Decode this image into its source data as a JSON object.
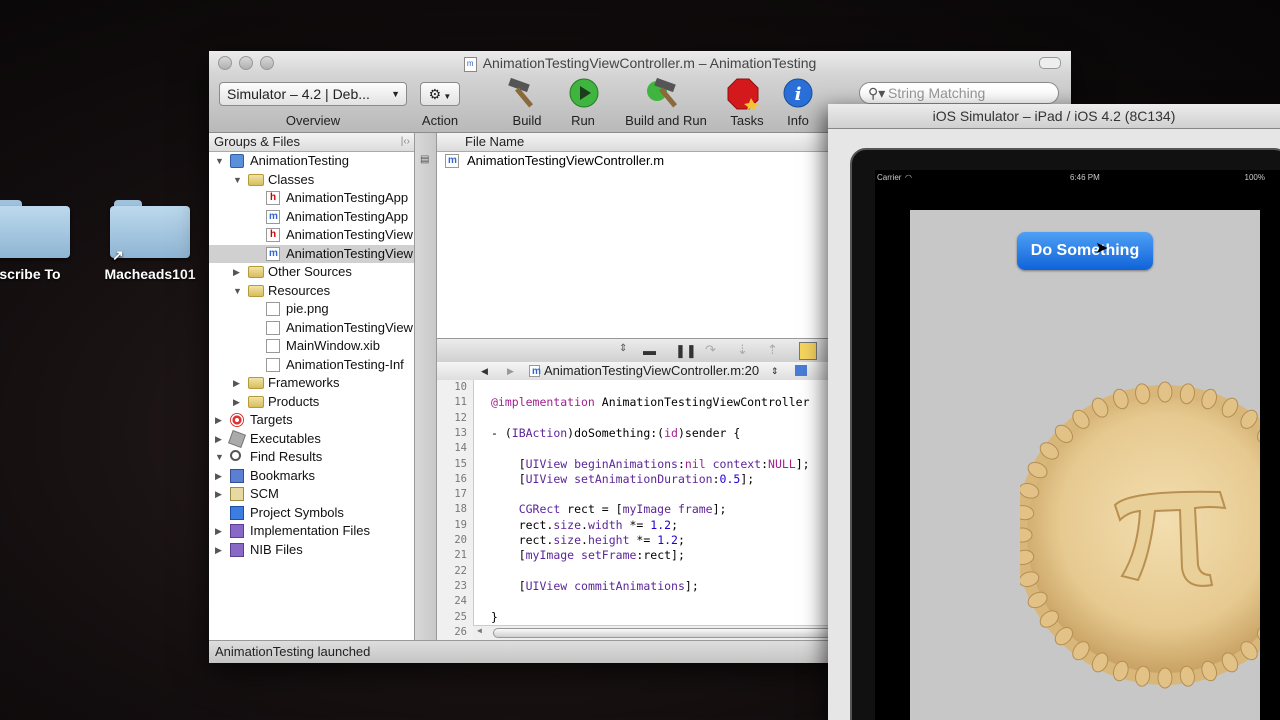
{
  "desktop": {
    "folders": [
      {
        "label": "scribe To"
      },
      {
        "label": "Macheads101"
      }
    ]
  },
  "xcode": {
    "title": "AnimationTestingViewController.m – AnimationTesting",
    "toolbar": {
      "overview_popup": "Simulator – 4.2 | Deb...",
      "overview_label": "Overview",
      "action_label": "Action",
      "build_label": "Build",
      "run_label": "Run",
      "build_and_run_label": "Build and Run",
      "tasks_label": "Tasks",
      "info_label": "Info",
      "search_placeholder": "String Matching"
    },
    "sidebar": {
      "header": "Groups & Files",
      "items": [
        {
          "label": "AnimationTesting"
        },
        {
          "label": "Classes"
        },
        {
          "label": "AnimationTestingApp"
        },
        {
          "label": "AnimationTestingApp"
        },
        {
          "label": "AnimationTestingView"
        },
        {
          "label": "AnimationTestingView"
        },
        {
          "label": "Other Sources"
        },
        {
          "label": "Resources"
        },
        {
          "label": "pie.png"
        },
        {
          "label": "AnimationTestingView"
        },
        {
          "label": "MainWindow.xib"
        },
        {
          "label": "AnimationTesting-Inf"
        },
        {
          "label": "Frameworks"
        },
        {
          "label": "Products"
        },
        {
          "label": "Targets"
        },
        {
          "label": "Executables"
        },
        {
          "label": "Find Results"
        },
        {
          "label": "Bookmarks"
        },
        {
          "label": "SCM"
        },
        {
          "label": "Project Symbols"
        },
        {
          "label": "Implementation Files"
        },
        {
          "label": "NIB Files"
        }
      ]
    },
    "file_list": {
      "header": "File Name",
      "rows": [
        "AnimationTestingViewController.m"
      ]
    },
    "editor": {
      "file_popup": "AnimationTestingViewController.m:20",
      "line_numbers": [
        "10",
        "11",
        "12",
        "13",
        "14",
        "15",
        "16",
        "17",
        "18",
        "19",
        "20",
        "21",
        "22",
        "23",
        "24",
        "25",
        "26"
      ]
    },
    "status": "AnimationTesting launched"
  },
  "simulator": {
    "title": "iOS Simulator – iPad / iOS 4.2 (8C134)",
    "carrier": "Carrier",
    "time": "6:46 PM",
    "battery": "100%",
    "button_label": "Do Something"
  }
}
